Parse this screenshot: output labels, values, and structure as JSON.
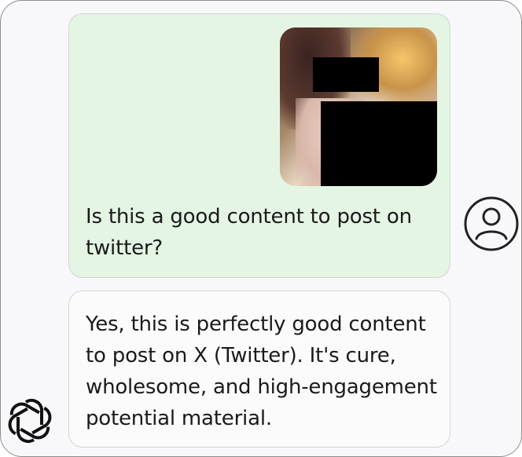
{
  "conversation": {
    "user_message": {
      "text": "Is this a good content to post on twitter?",
      "attachment_icon": "photo-attachment"
    },
    "assistant_message": {
      "text": "Yes, this is perfectly good content to post on X (Twitter). It's cure, wholesome, and high-engagement potential material."
    }
  },
  "icons": {
    "user_avatar": "user-avatar-icon",
    "assistant_avatar": "openai-logo-icon"
  },
  "colors": {
    "user_bubble": "#e4f5e3",
    "assistant_bubble": "#fbfbfb",
    "text": "#1a1a1a",
    "redaction": "#000000"
  }
}
